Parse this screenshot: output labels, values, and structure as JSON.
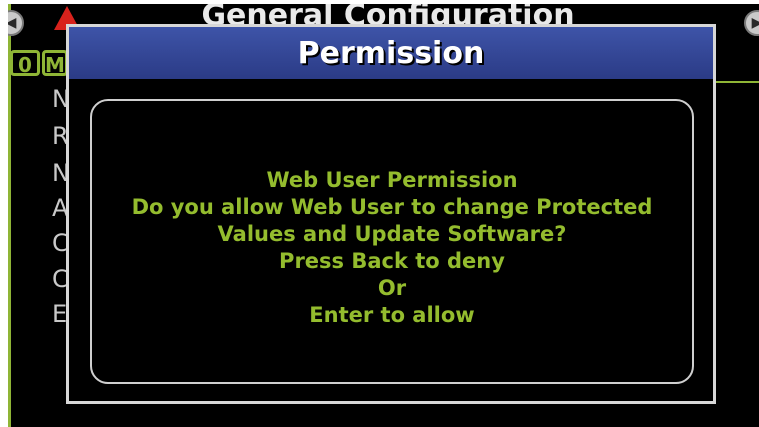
{
  "background": {
    "title": "General Configuration",
    "badges": [
      "0",
      "M"
    ],
    "menu_letters": [
      "N",
      "R",
      "N",
      "A",
      "C",
      "C",
      "E"
    ]
  },
  "icons": {
    "nav_left": "chevron-left-icon",
    "nav_right": "chevron-right-icon",
    "warning": "warning-icon"
  },
  "dialog": {
    "title": "Permission",
    "lines": [
      "Web User Permission",
      "Do you allow Web User to change Protected",
      "Values and Update Software?",
      "Press Back to deny",
      "Or",
      "Enter to allow"
    ]
  },
  "colors": {
    "accent_green": "#94bc2e",
    "header_blue": "#3e54a8",
    "warning_red": "#d8221c"
  }
}
